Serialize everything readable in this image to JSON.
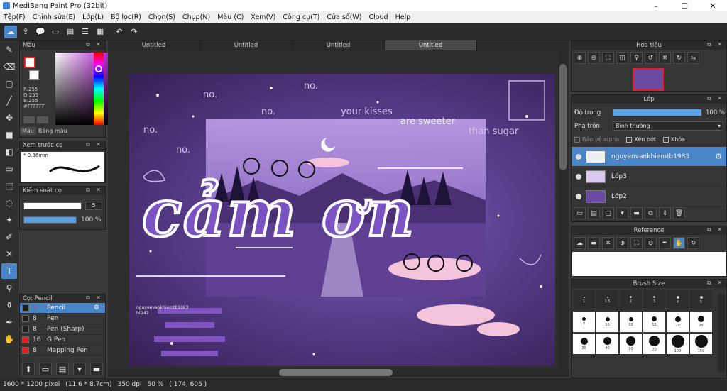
{
  "window": {
    "title": "MediBang Paint Pro (32bit)"
  },
  "menu": [
    "Tệp(F)",
    "Chỉnh sửa(E)",
    "Lớp(L)",
    "Bộ lọc(R)",
    "Chọn(S)",
    "Chụp(N)",
    "Màu (C)",
    "Xem(V)",
    "Công cụ(T)",
    "Cửa sổ(W)",
    "Cloud",
    "Help"
  ],
  "tabs": [
    "Untitled",
    "Untitled",
    "Untitled",
    "Untitled"
  ],
  "color_panel": {
    "title": "Màu",
    "rgb_r": "R:255",
    "rgb_g": "G:255",
    "rgb_b": "B:255",
    "hex": "#FFFFFF",
    "tab1": "Màu",
    "tab2": "Bảng màu"
  },
  "brush_preview": {
    "title": "Xem trước cọ",
    "size": "* 0.36mm"
  },
  "brush_control": {
    "title": "Kiểm soát cọ",
    "size_value": "5",
    "opacity_value": "100 %"
  },
  "brush_list": {
    "title": "Cọ: Pencil",
    "items": [
      {
        "size": "5",
        "name": "Pencil",
        "color": "#1e1e1e"
      },
      {
        "size": "8",
        "name": "Pen",
        "color": "#1e1e1e"
      },
      {
        "size": "8",
        "name": "Pen (Sharp)",
        "color": "#1e1e1e"
      },
      {
        "size": "16",
        "name": "G Pen",
        "color": "#e02020"
      },
      {
        "size": "8",
        "name": "Mapping Pen",
        "color": "#e02020"
      }
    ]
  },
  "navigator": {
    "title": "Hoa tiêu"
  },
  "layers": {
    "title": "Lớp",
    "opacity_label": "Độ trong",
    "opacity_value": "100 %",
    "blend_label": "Pha trộn",
    "blend_value": "Bình thường",
    "protect_alpha": "Bảo vệ alpha",
    "clipping": "Xén bớt",
    "lock": "Khóa",
    "items": [
      {
        "name": "nguyenvankhiemtb1983"
      },
      {
        "name": "Lớp3"
      },
      {
        "name": "Lớp2"
      }
    ]
  },
  "reference": {
    "title": "Reference"
  },
  "brush_size": {
    "title": "Brush Size",
    "labels": [
      "1",
      "1.5",
      "2",
      "3",
      "4",
      "5",
      "7",
      "10",
      "12",
      "15",
      "20",
      "25",
      "30",
      "40",
      "50",
      "70",
      "100",
      "150"
    ]
  },
  "artwork": {
    "main_text": "cảm ơn",
    "bg_words": [
      "no.",
      "no.",
      "no.",
      "no.",
      "no.",
      "your kisses",
      "are sweeter",
      "than sugar"
    ],
    "credit": "nguyenvankhiemtb1983",
    "credit2": "ht247"
  },
  "status": {
    "pixels": "1600 * 1200 pixel",
    "cm": "(11.6 * 8.7cm)",
    "dpi": "350 dpi",
    "zoom": "50 %",
    "coords": "( 174, 605 )"
  },
  "colors": {
    "accent": "#4a86c7",
    "panel": "#353535",
    "artwork_purple": "#6b4aa3"
  }
}
